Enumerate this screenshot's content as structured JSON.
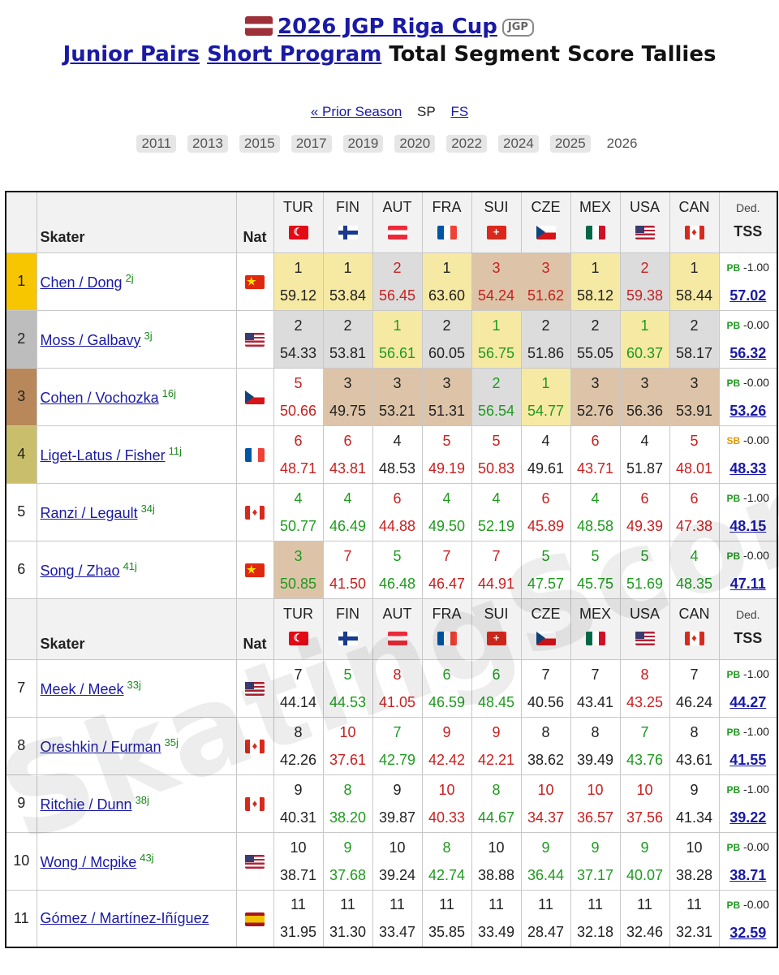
{
  "header": {
    "event_link": "2026 JGP Riga Cup",
    "badge": "JGP",
    "category_link": "Junior Pairs",
    "segment_link": "Short Program",
    "title_rest": "Total Segment Score Tallies"
  },
  "segment_nav": {
    "prior": "« Prior Season",
    "current": "SP",
    "other": "FS"
  },
  "years": [
    "2011",
    "2013",
    "2015",
    "2017",
    "2019",
    "2020",
    "2022",
    "2024",
    "2025",
    "2026"
  ],
  "current_year": "2026",
  "table_header": {
    "skater": "Skater",
    "nat": "Nat",
    "ded": "Ded.",
    "tss": "TSS"
  },
  "judges": [
    "TUR",
    "FIN",
    "AUT",
    "FRA",
    "SUI",
    "CZE",
    "MEX",
    "USA",
    "CAN"
  ],
  "rows": [
    {
      "rank": "1",
      "name": "Chen / Dong",
      "sup": "2j",
      "nat": "CHN",
      "ord": [
        "1",
        "1",
        "2",
        "1",
        "3",
        "3",
        "1",
        "2",
        "1"
      ],
      "sc": [
        "59.12",
        "53.84",
        "56.45",
        "63.60",
        "54.24",
        "51.62",
        "58.12",
        "59.38",
        "58.44"
      ],
      "pbsb": "PB",
      "ded": "-1.00",
      "tss": "57.02"
    },
    {
      "rank": "2",
      "name": "Moss / Galbavy",
      "sup": "3j",
      "nat": "USA",
      "ord": [
        "2",
        "2",
        "1",
        "2",
        "1",
        "2",
        "2",
        "1",
        "2"
      ],
      "sc": [
        "54.33",
        "53.81",
        "56.61",
        "60.05",
        "56.75",
        "51.86",
        "55.05",
        "60.37",
        "58.17"
      ],
      "pbsb": "PB",
      "ded": "-0.00",
      "tss": "56.32"
    },
    {
      "rank": "3",
      "name": "Cohen / Vochozka",
      "sup": "16j",
      "nat": "CZE",
      "ord": [
        "5",
        "3",
        "3",
        "3",
        "2",
        "1",
        "3",
        "3",
        "3"
      ],
      "sc": [
        "50.66",
        "49.75",
        "53.21",
        "51.31",
        "56.54",
        "54.77",
        "52.76",
        "56.36",
        "53.91"
      ],
      "pbsb": "PB",
      "ded": "-0.00",
      "tss": "53.26"
    },
    {
      "rank": "4",
      "name": "Liget-Latus / Fisher",
      "sup": "11j",
      "nat": "FRA",
      "ord": [
        "6",
        "6",
        "4",
        "5",
        "5",
        "4",
        "6",
        "4",
        "5"
      ],
      "sc": [
        "48.71",
        "43.81",
        "48.53",
        "49.19",
        "50.83",
        "49.61",
        "43.71",
        "51.87",
        "48.01"
      ],
      "pbsb": "SB",
      "ded": "-0.00",
      "tss": "48.33"
    },
    {
      "rank": "5",
      "name": "Ranzi / Legault",
      "sup": "34j",
      "nat": "CAN",
      "ord": [
        "4",
        "4",
        "6",
        "4",
        "4",
        "6",
        "4",
        "6",
        "6"
      ],
      "sc": [
        "50.77",
        "46.49",
        "44.88",
        "49.50",
        "52.19",
        "45.89",
        "48.58",
        "49.39",
        "47.38"
      ],
      "pbsb": "PB",
      "ded": "-1.00",
      "tss": "48.15"
    },
    {
      "rank": "6",
      "name": "Song / Zhao",
      "sup": "41j",
      "nat": "CHN",
      "ord": [
        "3",
        "7",
        "5",
        "7",
        "7",
        "5",
        "5",
        "5",
        "4"
      ],
      "sc": [
        "50.85",
        "41.50",
        "46.48",
        "46.47",
        "44.91",
        "47.57",
        "45.75",
        "51.69",
        "48.35"
      ],
      "pbsb": "PB",
      "ded": "-0.00",
      "tss": "47.11"
    },
    {
      "rank": "7",
      "name": "Meek / Meek",
      "sup": "33j",
      "nat": "USA",
      "ord": [
        "7",
        "5",
        "8",
        "6",
        "6",
        "7",
        "7",
        "8",
        "7"
      ],
      "sc": [
        "44.14",
        "44.53",
        "41.05",
        "46.59",
        "48.45",
        "40.56",
        "43.41",
        "43.25",
        "46.24"
      ],
      "pbsb": "PB",
      "ded": "-1.00",
      "tss": "44.27"
    },
    {
      "rank": "8",
      "name": "Oreshkin / Furman",
      "sup": "35j",
      "nat": "CAN",
      "ord": [
        "8",
        "10",
        "7",
        "9",
        "9",
        "8",
        "8",
        "7",
        "8"
      ],
      "sc": [
        "42.26",
        "37.61",
        "42.79",
        "42.42",
        "42.21",
        "38.62",
        "39.49",
        "43.76",
        "43.61"
      ],
      "pbsb": "PB",
      "ded": "-1.00",
      "tss": "41.55"
    },
    {
      "rank": "9",
      "name": "Ritchie / Dunn",
      "sup": "38j",
      "nat": "CAN",
      "ord": [
        "9",
        "8",
        "9",
        "10",
        "8",
        "10",
        "10",
        "10",
        "9"
      ],
      "sc": [
        "40.31",
        "38.20",
        "39.87",
        "40.33",
        "44.67",
        "34.37",
        "36.57",
        "37.56",
        "41.34"
      ],
      "pbsb": "PB",
      "ded": "-1.00",
      "tss": "39.22"
    },
    {
      "rank": "10",
      "name": "Wong / Mcpike",
      "sup": "43j",
      "nat": "USA",
      "ord": [
        "10",
        "9",
        "10",
        "8",
        "10",
        "9",
        "9",
        "9",
        "10"
      ],
      "sc": [
        "38.71",
        "37.68",
        "39.24",
        "42.74",
        "38.88",
        "36.44",
        "37.17",
        "40.07",
        "38.28"
      ],
      "pbsb": "PB",
      "ded": "-0.00",
      "tss": "38.71"
    },
    {
      "rank": "11",
      "name": "Gómez / Martínez-Iñíguez",
      "sup": "",
      "nat": "ESP",
      "ord": [
        "11",
        "11",
        "11",
        "11",
        "11",
        "11",
        "11",
        "11",
        "11"
      ],
      "sc": [
        "31.95",
        "31.30",
        "33.47",
        "35.85",
        "33.49",
        "28.47",
        "32.18",
        "32.46",
        "32.31"
      ],
      "pbsb": "PB",
      "ded": "-0.00",
      "tss": "32.59"
    }
  ],
  "watermark": "SkatingScores.com"
}
